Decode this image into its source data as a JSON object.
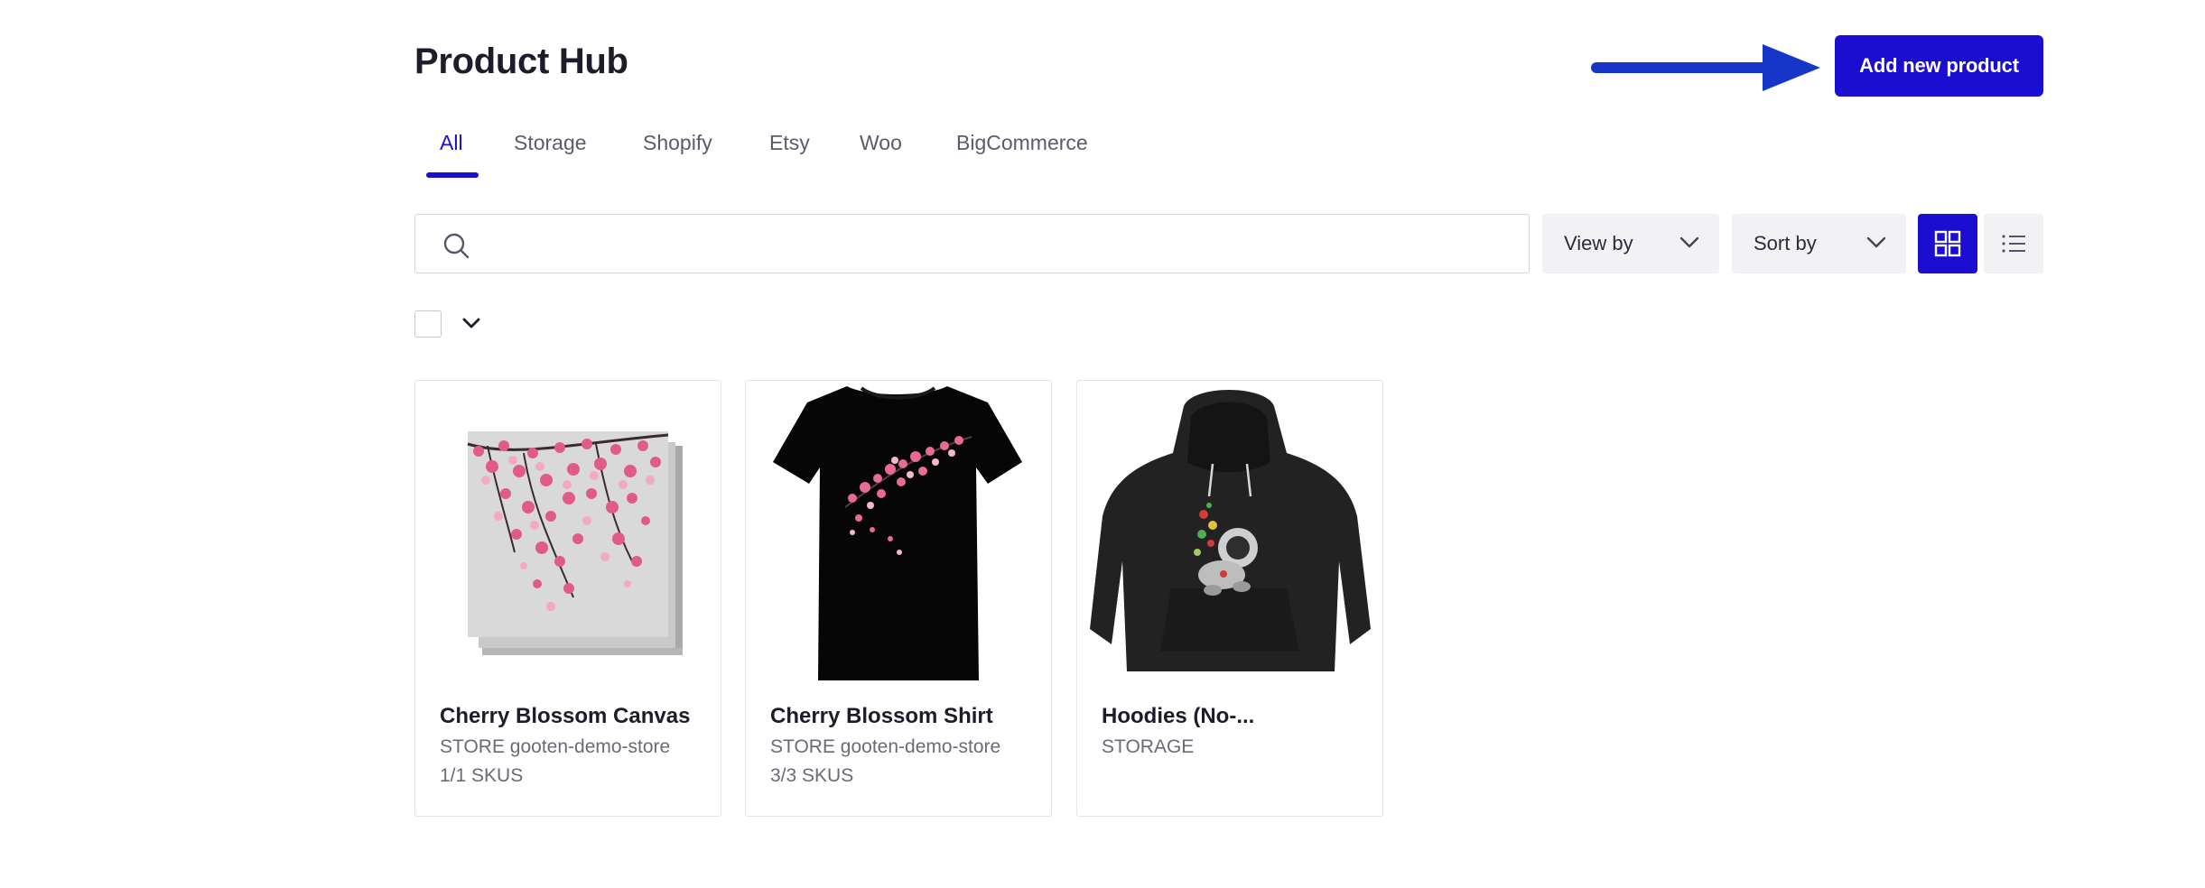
{
  "header": {
    "title": "Product Hub",
    "add_button_label": "Add new product"
  },
  "tabs": [
    {
      "label": "All",
      "active": true
    },
    {
      "label": "Storage",
      "active": false
    },
    {
      "label": "Shopify",
      "active": false
    },
    {
      "label": "Etsy",
      "active": false
    },
    {
      "label": "Woo",
      "active": false
    },
    {
      "label": "BigCommerce",
      "active": false
    }
  ],
  "toolbar": {
    "search_placeholder": "",
    "view_by_label": "View by",
    "sort_by_label": "Sort by",
    "view_mode": "grid"
  },
  "products": [
    {
      "name": "Cherry Blossom Canvas",
      "store": "STORE gooten-demo-store",
      "skus": "1/1 SKUS",
      "image": "canvas-print"
    },
    {
      "name": "Cherry Blossom Shirt",
      "store": "STORE gooten-demo-store",
      "skus": "3/3 SKUS",
      "image": "black-tshirt"
    },
    {
      "name": "Hoodies (No-...",
      "store": "STORAGE",
      "skus": "",
      "image": "black-hoodie"
    }
  ],
  "colors": {
    "accent": "#1b0ed0",
    "arrow": "#1536c8",
    "secondary_bg": "#f2f2f5"
  }
}
